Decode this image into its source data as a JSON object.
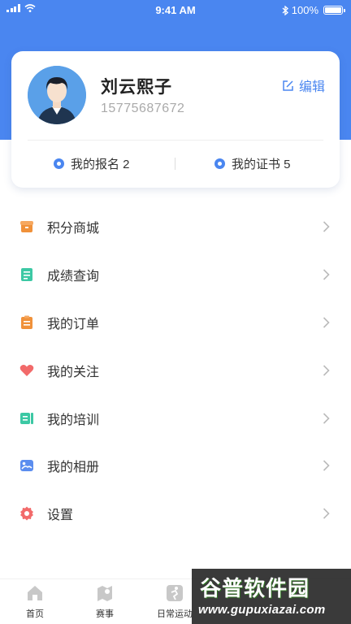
{
  "status_bar": {
    "time": "9:41 AM",
    "battery": "100%"
  },
  "profile": {
    "name": "刘云熙子",
    "phone": "15775687672",
    "edit_label": "编辑"
  },
  "stats": {
    "registrations_label": "我的报名 2",
    "certificates_label": "我的证书 5"
  },
  "menu": {
    "items": [
      {
        "label": "积分商城",
        "icon": "store-icon",
        "color": "#f0913a"
      },
      {
        "label": "成绩查询",
        "icon": "score-icon",
        "color": "#3cc8a4"
      },
      {
        "label": "我的订单",
        "icon": "order-icon",
        "color": "#f0913a"
      },
      {
        "label": "我的关注",
        "icon": "heart-icon",
        "color": "#f26a6a"
      },
      {
        "label": "我的培训",
        "icon": "training-icon",
        "color": "#3cc8a4"
      },
      {
        "label": "我的相册",
        "icon": "album-icon",
        "color": "#5b8def"
      },
      {
        "label": "设置",
        "icon": "settings-icon",
        "color": "#f26a6a"
      }
    ]
  },
  "tabbar": {
    "tabs": [
      {
        "label": "首页",
        "icon": "home-icon"
      },
      {
        "label": "赛事",
        "icon": "event-map-icon"
      },
      {
        "label": "日常运动",
        "icon": "running-icon"
      }
    ]
  },
  "watermark": {
    "title": "谷普软件园",
    "url": "www.gupuxiazai.com"
  },
  "colors": {
    "accent": "#4a86f0",
    "header_bg": "#4a86f0"
  }
}
